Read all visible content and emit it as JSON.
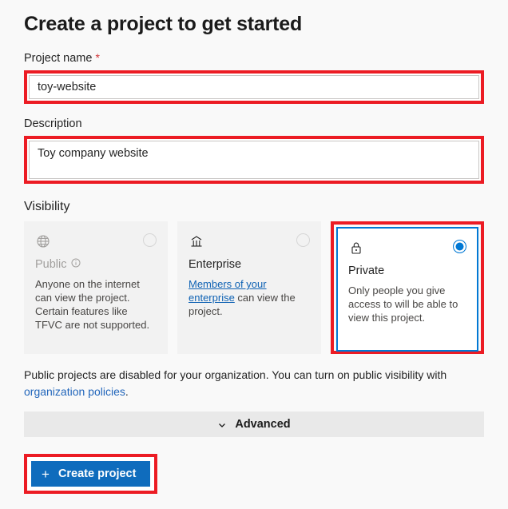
{
  "page": {
    "title": "Create a project to get started"
  },
  "form": {
    "project_name": {
      "label": "Project name",
      "required_marker": "*",
      "value": "toy-website",
      "placeholder": ""
    },
    "description": {
      "label": "Description",
      "value": "Toy company website",
      "placeholder": ""
    }
  },
  "visibility": {
    "section_label": "Visibility",
    "options": [
      {
        "id": "public",
        "icon": "globe-icon",
        "title": "Public",
        "info_icon": "info-icon",
        "description": "Anyone on the internet can view the project. Certain features like TFVC are not supported.",
        "selected": false,
        "disabled": true
      },
      {
        "id": "enterprise",
        "icon": "bank-icon",
        "title": "Enterprise",
        "description_link": "Members of your enterprise",
        "description_rest": " can view the project.",
        "selected": false,
        "disabled": false
      },
      {
        "id": "private",
        "icon": "lock-icon",
        "title": "Private",
        "description": "Only people you give access to will be able to view this project.",
        "selected": true,
        "disabled": false
      }
    ]
  },
  "note": {
    "text_before": "Public projects are disabled for your organization. You can turn on public visibility with ",
    "link": "organization policies",
    "text_after": "."
  },
  "advanced": {
    "label": "Advanced",
    "chevron": "chevron-down-icon"
  },
  "actions": {
    "create_label": "Create project",
    "plus": "+"
  },
  "colors": {
    "accent": "#0078d4",
    "button": "#0f6cbd",
    "annotation": "#ec1c24",
    "required": "#d13438",
    "link": "#0f62b4"
  }
}
